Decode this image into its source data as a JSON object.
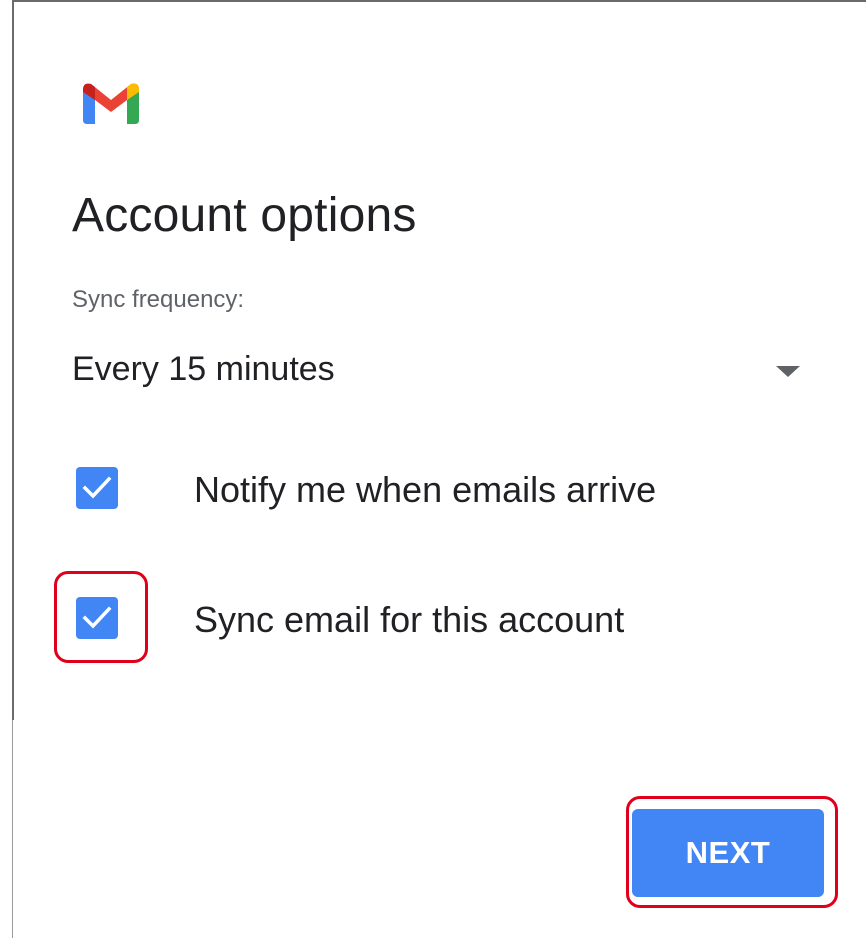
{
  "app": {
    "logo_icon": "gmail-logo-icon"
  },
  "page": {
    "title": "Account options"
  },
  "sync": {
    "label": "Sync frequency:",
    "selected_value": "Every 15 minutes",
    "caret_icon": "dropdown-caret-icon"
  },
  "options": {
    "notify": {
      "label": "Notify me when emails arrive",
      "checked": true
    },
    "sync_email": {
      "label": "Sync email for this account",
      "checked": true
    }
  },
  "actions": {
    "next_label": "NEXT"
  },
  "colors": {
    "accent": "#4285f4",
    "highlight": "#e0001b",
    "text_primary": "#202124",
    "text_secondary": "#5f6368"
  }
}
